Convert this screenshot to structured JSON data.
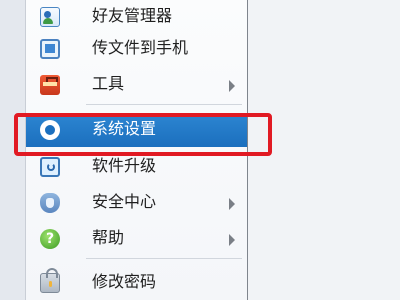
{
  "menu": {
    "items": [
      {
        "label": "好友管理器",
        "icon": "friends-icon",
        "has_submenu": false
      },
      {
        "label": "传文件到手机",
        "icon": "phone-transfer-icon",
        "has_submenu": false
      },
      {
        "label": "工具",
        "icon": "toolbox-icon",
        "has_submenu": true
      },
      {
        "label": "系统设置",
        "icon": "gear-icon",
        "has_submenu": false,
        "selected": true
      },
      {
        "label": "软件升级",
        "icon": "upgrade-icon",
        "has_submenu": false
      },
      {
        "label": "安全中心",
        "icon": "shield-icon",
        "has_submenu": true
      },
      {
        "label": "帮助",
        "icon": "help-icon",
        "has_submenu": true
      },
      {
        "label": "修改密码",
        "icon": "lock-icon",
        "has_submenu": false
      }
    ]
  },
  "colors": {
    "selected_bg": "#1b6fbe",
    "highlight_border": "#e11a23"
  }
}
